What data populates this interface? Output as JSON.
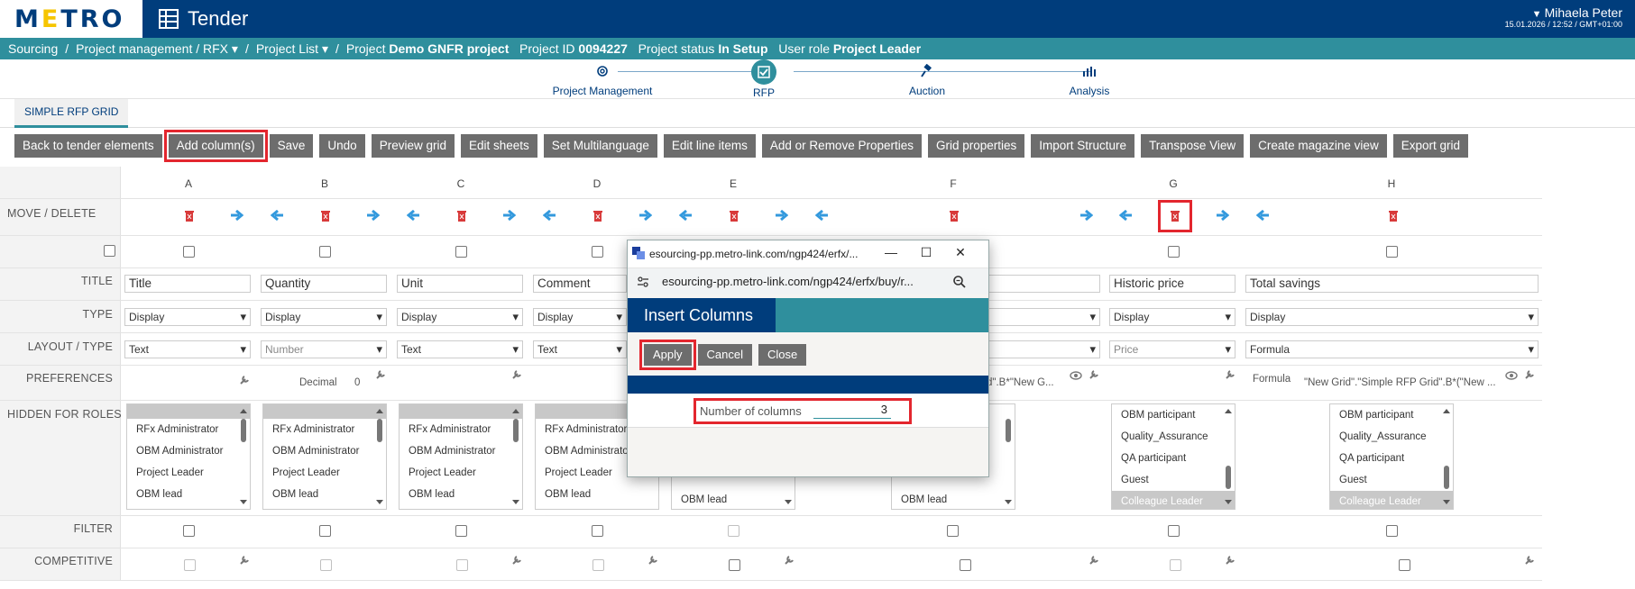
{
  "header": {
    "logo": "METRO",
    "app_title": "Tender",
    "user_name": "Mihaela Peter",
    "user_datetime": "15.01.2026 / 12:52 / GMT+01:00"
  },
  "breadcrumb": {
    "sourcing": "Sourcing",
    "project_mgmt": "Project management / RFX",
    "project_list": "Project List",
    "project_prefix": "Project",
    "project_name": "Demo GNFR project",
    "project_id_label": "Project ID",
    "project_id": "0094227",
    "status_label": "Project status",
    "status": "In Setup",
    "role_label": "User role",
    "role": "Project Leader"
  },
  "steps": [
    {
      "label": "Project Management",
      "icon": "gear-icon"
    },
    {
      "label": "RFP",
      "icon": "rfp-check-icon",
      "active": true
    },
    {
      "label": "Auction",
      "icon": "gavel-icon"
    },
    {
      "label": "Analysis",
      "icon": "bar-chart-icon"
    }
  ],
  "tab": {
    "label": "SIMPLE RFP GRID"
  },
  "toolbar": [
    "Back to tender elements",
    "Add column(s)",
    "Save",
    "Undo",
    "Preview grid",
    "Edit sheets",
    "Set Multilanguage",
    "Edit line items",
    "Add or Remove Properties",
    "Grid properties",
    "Import Structure",
    "Transpose View",
    "Create magazine view",
    "Export grid"
  ],
  "row_labels": {
    "move_delete": "MOVE / DELETE",
    "title": "TITLE",
    "type": "TYPE",
    "layout_type": "LAYOUT / TYPE",
    "preferences": "PREFERENCES",
    "hidden_for_roles": "HIDDEN FOR ROLES",
    "filter": "FILTER",
    "competitive": "COMPETITIVE"
  },
  "columns": [
    "A",
    "B",
    "C",
    "D",
    "E",
    "F",
    "G",
    "H"
  ],
  "titles": {
    "A": "Title",
    "B": "Quantity",
    "C": "Unit",
    "D": "Comment",
    "G": "Historic price",
    "H": "Total savings"
  },
  "types": {
    "A": "Display",
    "B": "Display",
    "C": "Display",
    "D": "Display",
    "G": "Display",
    "H": "Display"
  },
  "layouts": {
    "A": "Text",
    "B": "Number",
    "C": "Text",
    "D": "Text",
    "G": "Price",
    "H": "Formula"
  },
  "preferences": {
    "decimal_label": "Decimal",
    "decimal_value": "0",
    "f_formula": "d\".B*\"New G...",
    "formula_label": "Formula",
    "formula_value": "\"New Grid\".\"Simple RFP Grid\".B*(\"New ..."
  },
  "roles_top": [
    "RFx Administrator",
    "OBM Administrator",
    "Project Leader",
    "OBM lead"
  ],
  "roles_bottom": [
    "OBM participant",
    "Quality_Assurance",
    "QA participant",
    "Guest",
    "Colleague Leader"
  ],
  "roles_partial": "OBM lead",
  "dialog": {
    "window_title": "esourcing-pp.metro-link.com/ngp424/erfx/...",
    "url": "esourcing-pp.metro-link.com/ngp424/erfx/buy/r...",
    "heading": "Insert Columns",
    "apply": "Apply",
    "cancel": "Cancel",
    "close": "Close",
    "field_label": "Number of columns",
    "field_value": "3"
  },
  "colors": {
    "brand_blue": "#003d7c",
    "teal": "#2f8f9d",
    "highlight_red": "#e3262e",
    "trash_red": "#d83a3a",
    "arrow_blue": "#3399dd"
  }
}
